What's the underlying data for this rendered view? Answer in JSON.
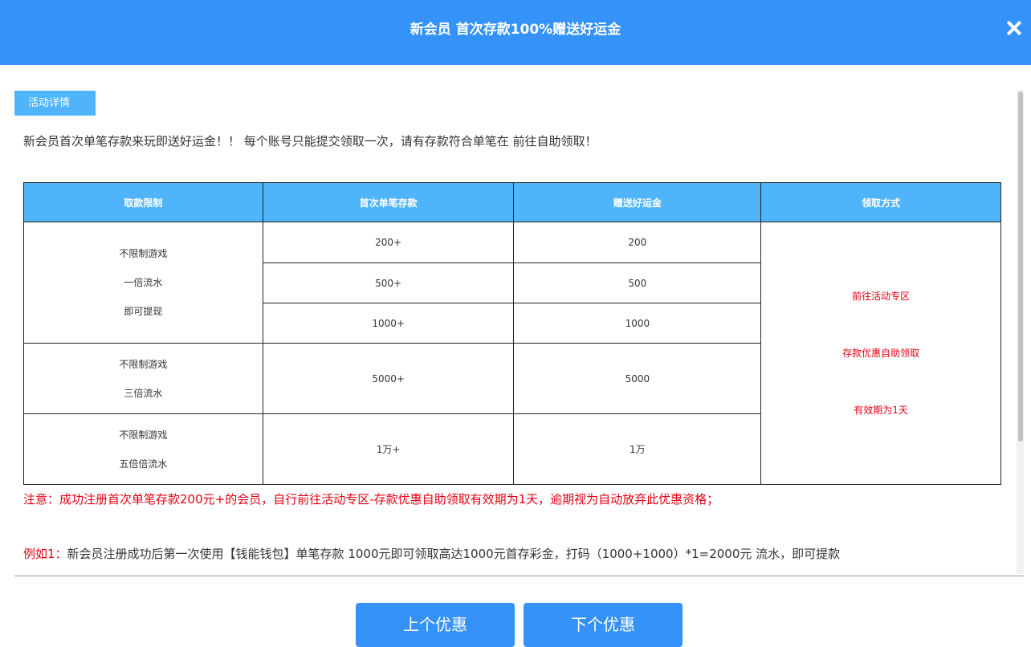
{
  "dialog": {
    "title": "新会员 首次存款100%赠送好运金",
    "close_icon": "close-icon"
  },
  "tab_label": "活动详情",
  "intro": "新会员首次单笔存款来玩即送好运金！！ 每个账号只能提交领取一次，请有存款符合单笔在 前往自助领取！",
  "table": {
    "headers": [
      "取款限制",
      "首次单笔存款",
      "赠送好运金",
      "领取方式"
    ],
    "groups": [
      {
        "limit_lines": [
          "不限制游戏",
          "一倍流水",
          "即可提现"
        ],
        "rows": [
          {
            "deposit": "200+",
            "bonus": "200"
          },
          {
            "deposit": "500+",
            "bonus": "500"
          },
          {
            "deposit": "1000+",
            "bonus": "1000"
          }
        ]
      },
      {
        "limit_lines": [
          "不限制游戏",
          "三倍流水"
        ],
        "rows": [
          {
            "deposit": "5000+",
            "bonus": "5000"
          }
        ]
      },
      {
        "limit_lines": [
          "不限制游戏",
          "五倍倍流水"
        ],
        "rows": [
          {
            "deposit": "1万+",
            "bonus": "1万"
          }
        ]
      }
    ],
    "method_lines": [
      "前往活动专区",
      "存款优惠自助领取",
      "有效期为1天"
    ]
  },
  "note": "注意：成功注册首次单笔存款200元+的会员，自行前往活动专区-存款优惠自助领取有效期为1天，逾期视为自动放弃此优惠资格；",
  "example": {
    "label": "例如1：",
    "text": "新会员注册成功后第一次使用【钱能钱包】单笔存款 1000元即可领取高达1000元首存彩金，打码（1000+1000）*1=2000元 流水，即可提款"
  },
  "buttons": {
    "prev": "上个优惠",
    "next": "下个优惠"
  },
  "colors": {
    "header": "#3592f9",
    "table_header": "#4fb4f9",
    "accent_red": "#e60012"
  }
}
